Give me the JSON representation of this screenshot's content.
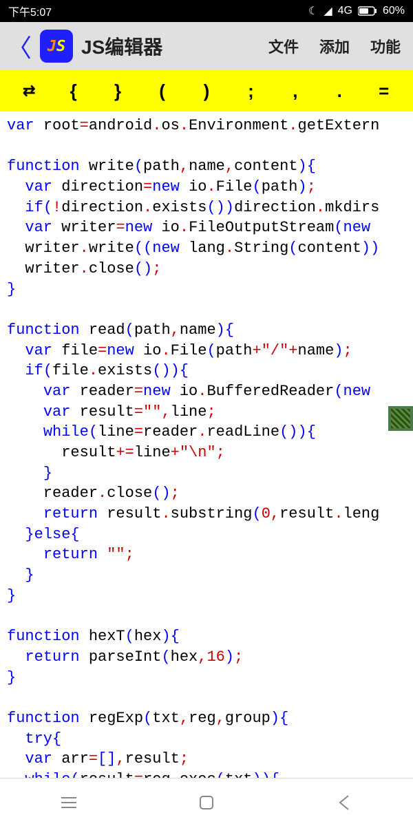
{
  "status": {
    "time": "下午5:07",
    "network": "4G",
    "battery": "60%"
  },
  "header": {
    "title": "JS编辑器",
    "icon_j": "J",
    "icon_s": "S",
    "menu": {
      "file": "文件",
      "add": "添加",
      "function": "功能"
    }
  },
  "symbols": {
    "swap": "⇄",
    "lbrace": "{",
    "rbrace": "}",
    "lparen": "(",
    "rparen": ")",
    "semi": ";",
    "comma": ",",
    "dot": ".",
    "eq": "="
  },
  "code": {
    "lines": [
      {
        "t": "kw",
        "v": "var "
      },
      {
        "t": "ident",
        "v": "root"
      },
      {
        "t": "op",
        "v": "="
      },
      {
        "t": "ident",
        "v": "android"
      },
      {
        "t": "punc",
        "v": "."
      },
      {
        "t": "ident",
        "v": "os"
      },
      {
        "t": "punc",
        "v": "."
      },
      {
        "t": "ident",
        "v": "Environment"
      },
      {
        "t": "punc",
        "v": "."
      },
      {
        "t": "ident",
        "v": "getExtern"
      }
    ]
  }
}
